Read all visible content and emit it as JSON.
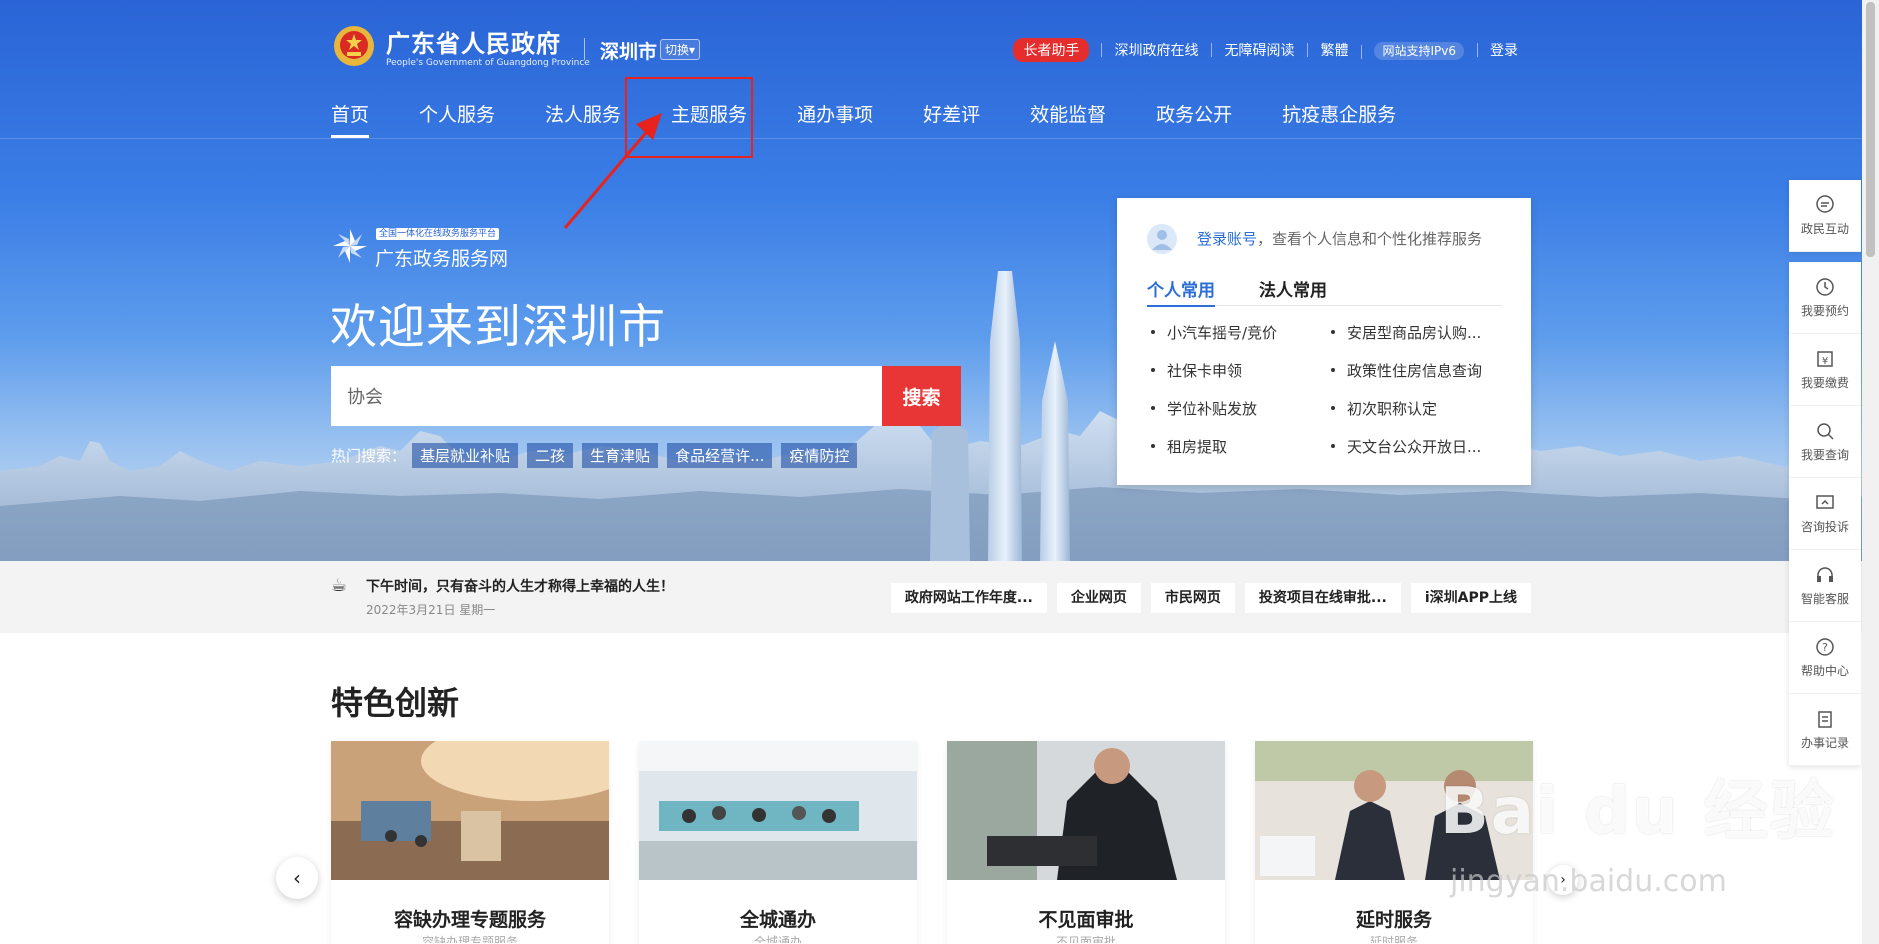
{
  "header": {
    "site_title": "广东省人民政府",
    "site_subtitle": "People's Government of Guangdong Province",
    "city": "深圳市",
    "switch_label": "切换",
    "elder_mode": "长者助手",
    "links": [
      "深圳政府在线",
      "无障碍阅读",
      "繁體",
      "网站支持IPv6",
      "登录"
    ]
  },
  "nav": {
    "items": [
      "首页",
      "个人服务",
      "法人服务",
      "主题服务",
      "通办事项",
      "好差评",
      "效能监督",
      "政务公开",
      "抗疫惠企服务"
    ],
    "active": "首页"
  },
  "platform": {
    "tag": "全国一体化在线政务服务平台",
    "name": "广东政务服务网"
  },
  "welcome": "欢迎来到深圳市",
  "search": {
    "value": "协会",
    "button": "搜索",
    "hot_label": "热门搜索：",
    "hot_tags": [
      "基层就业补贴",
      "二孩",
      "生育津贴",
      "食品经营许...",
      "疫情防控"
    ]
  },
  "card": {
    "login_link": "登录账号",
    "login_text": "，查看个人信息和个性化推荐服务",
    "tabs": [
      "个人常用",
      "法人常用"
    ],
    "items": [
      "小汽车摇号/竞价",
      "安居型商品房认购...",
      "社保卡申领",
      "政策性住房信息查询",
      "学位补贴发放",
      "初次职称认定",
      "租房提取",
      "天文台公众开放日..."
    ]
  },
  "notice": {
    "message": "下午时间，只有奋斗的人生才称得上幸福的人生！",
    "date": "2022年3月21日 星期一",
    "quick_links": [
      "政府网站工作年度...",
      "企业网页",
      "市民网页",
      "投资项目在线审批...",
      "i深圳APP上线"
    ]
  },
  "features": {
    "title": "特色创新",
    "cards": [
      {
        "title": "容缺办理专题服务",
        "desc": "...容缺办理专题服务..."
      },
      {
        "title": "全城通办",
        "desc": "...全城通办..."
      },
      {
        "title": "不见面审批",
        "desc": "...不见面审批..."
      },
      {
        "title": "延时服务",
        "desc": "...延时服务..."
      }
    ]
  },
  "sidebar": {
    "items": [
      "政民互动",
      "我要预约",
      "我要缴费",
      "我要查询",
      "咨询投诉",
      "智能客服",
      "帮助中心",
      "办事记录"
    ]
  },
  "watermark": {
    "main": "Bai du 经验",
    "sub": "jingyan.baidu.com"
  }
}
